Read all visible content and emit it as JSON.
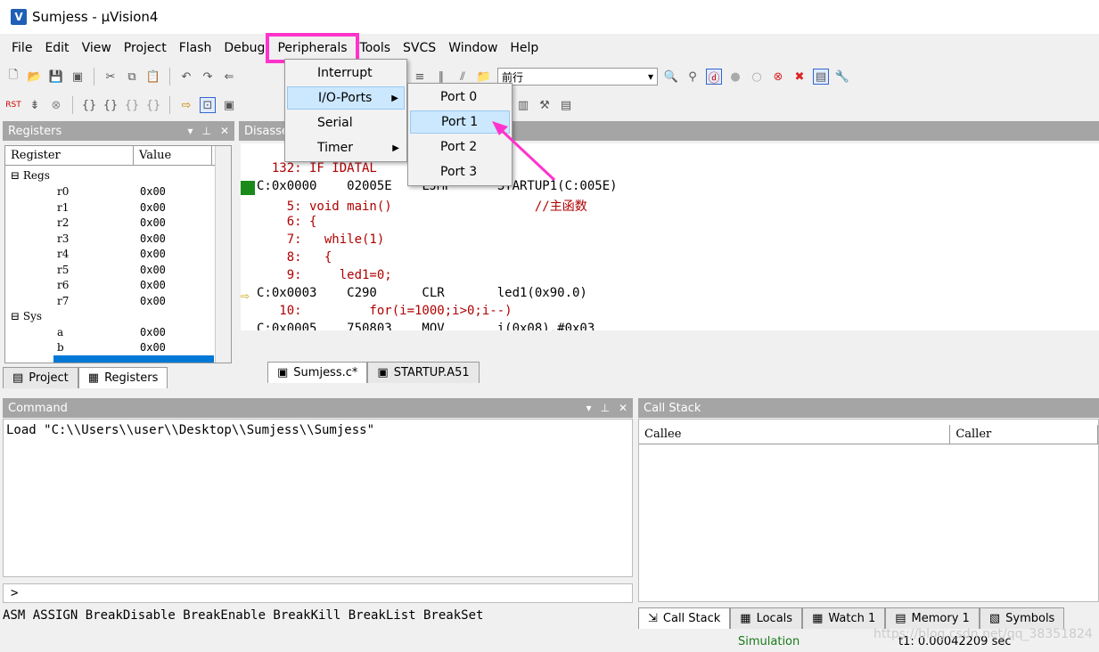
{
  "window": {
    "title": "Sumjess  - µVision4"
  },
  "menubar": [
    "File",
    "Edit",
    "View",
    "Project",
    "Flash",
    "Debug",
    "Peripherals",
    "Tools",
    "SVCS",
    "Window",
    "Help"
  ],
  "toolbar": {
    "find_combo": "前行"
  },
  "registers": {
    "title": "Registers",
    "col_register": "Register",
    "col_value": "Value",
    "group_regs": "Regs",
    "regs": [
      {
        "name": "r0",
        "value": "0x00"
      },
      {
        "name": "r1",
        "value": "0x00"
      },
      {
        "name": "r2",
        "value": "0x00"
      },
      {
        "name": "r3",
        "value": "0x00"
      },
      {
        "name": "r4",
        "value": "0x00"
      },
      {
        "name": "r5",
        "value": "0x00"
      },
      {
        "name": "r6",
        "value": "0x00"
      },
      {
        "name": "r7",
        "value": "0x00"
      }
    ],
    "group_sys": "Sys",
    "sys": [
      {
        "name": "a",
        "value": "0x00"
      },
      {
        "name": "b",
        "value": "0x00"
      }
    ],
    "tab_project": "Project",
    "tab_registers": "Registers"
  },
  "disassembly": {
    "title": "Disasse",
    "lines": [
      {
        "text": "  132: IF IDATAL",
        "color": "red"
      },
      {
        "text": "C:0x0000    02005E    LJMP      STARTUP1(C:005E)",
        "color": "black"
      },
      {
        "text": "    5: void main()                   //主函数",
        "color": "red"
      },
      {
        "text": "    6: {",
        "color": "red"
      },
      {
        "text": "    7:   while(1)",
        "color": "red"
      },
      {
        "text": "    8:   {",
        "color": "red"
      },
      {
        "text": "    9:     led1=0;",
        "color": "red"
      },
      {
        "text": "C:0x0003    C290      CLR       led1(0x90.0)",
        "color": "black"
      },
      {
        "text": "   10:         for(i=1000;i>0;i--)",
        "color": "red"
      },
      {
        "text": "C:0x0005    750803    MOV       i(0x08),#0x03",
        "color": "black"
      }
    ]
  },
  "editor_tabs": [
    "Sumjess.c*",
    "STARTUP.A51"
  ],
  "command": {
    "title": "Command",
    "output": "Load \"C:\\\\Users\\\\user\\\\Desktop\\\\Sumjess\\\\Sumjess\"",
    "prompt": ">",
    "hints": "ASM ASSIGN BreakDisable BreakEnable BreakKill BreakList BreakSet"
  },
  "callstack": {
    "title": "Call Stack",
    "col_callee": "Callee",
    "col_caller": "Caller",
    "tabs": [
      "Call Stack",
      "Locals",
      "Watch 1",
      "Memory 1",
      "Symbols"
    ]
  },
  "peripherals_menu": {
    "items": [
      "Interrupt",
      "I/O-Ports",
      "Serial",
      "Timer"
    ],
    "io_submenu": [
      "Port 0",
      "Port 1",
      "Port 2",
      "Port 3"
    ]
  },
  "status": {
    "mode": "Simulation",
    "time": "t1: 0.00042209 sec",
    "watermark": "https://blog.csdn.net/qq_38351824"
  },
  "colors": {
    "highlight": "#ff33cc",
    "panel_header": "#a5a5a5",
    "code_red": "#b00000"
  }
}
